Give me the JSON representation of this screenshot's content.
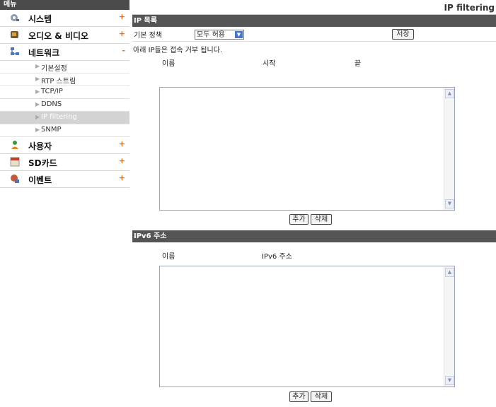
{
  "sidebar": {
    "header": "메뉴",
    "items": [
      {
        "label": "시스템",
        "mark": "+",
        "icon": "system-icon"
      },
      {
        "label": "오디오 & 비디오",
        "mark": "+",
        "icon": "audio-video-icon"
      },
      {
        "label": "네트워크",
        "mark": "-",
        "icon": "network-icon"
      }
    ],
    "network_sub": [
      "기본설정",
      "RTP 스트림",
      "TCP/IP",
      "DDNS",
      "IP filtering",
      "SNMP"
    ],
    "items2": [
      {
        "label": "사용자",
        "mark": "+",
        "icon": "user-icon"
      },
      {
        "label": "SD카드",
        "mark": "+",
        "icon": "sd-card-icon"
      },
      {
        "label": "이벤트",
        "mark": "+",
        "icon": "event-icon"
      }
    ]
  },
  "main": {
    "title": "IP filtering",
    "ip_section": {
      "title": "IP 목록",
      "policy_label": "기본 정책",
      "policy_value": "모두 허용",
      "save_label": "저장",
      "note": "아래 IP들은 접속 거부 됩니다.",
      "col_name": "이름",
      "col_start": "시작",
      "col_end": "끝",
      "add_label": "추가",
      "delete_label": "삭제"
    },
    "ipv6_section": {
      "title": "IPv6 주소",
      "col_name": "이름",
      "col_addr": "IPv6 주소",
      "add_label": "추가",
      "delete_label": "삭제"
    }
  }
}
